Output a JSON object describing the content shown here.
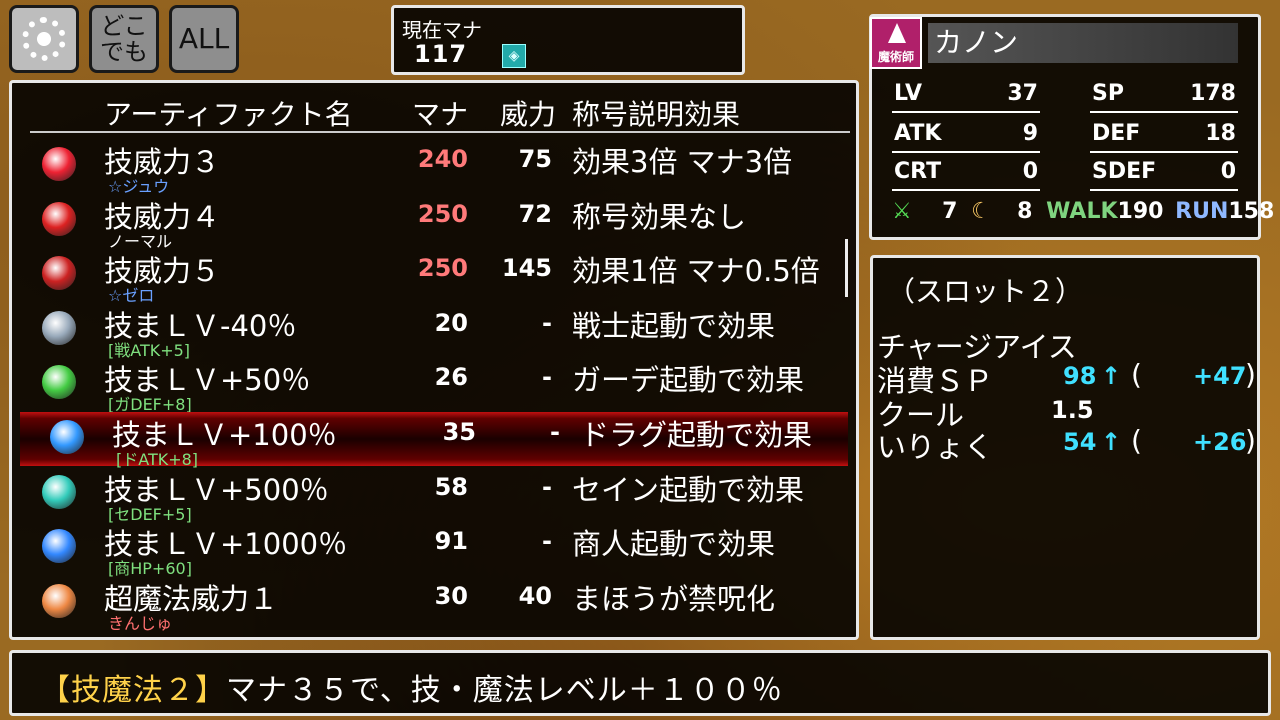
{
  "top_buttons": {
    "settings_icon": "gear-icon",
    "anywhere_label": "どこでも",
    "all_label": "ALL"
  },
  "mana": {
    "label": "現在マナ",
    "value": "117",
    "icon": "mana-crystal-icon"
  },
  "list": {
    "headers": {
      "name": "アーティファクト名",
      "mana": "マナ",
      "power": "威力",
      "effect": "称号説明効果"
    },
    "rows": [
      {
        "name": "技威力３",
        "sub": "☆ジュウ",
        "sub_color": "#6aa0ff",
        "mana": "240",
        "mana_color": "#ff7a7a",
        "power": "75",
        "effect": "効果3倍 マナ3倍",
        "icon": "plant-monster-icon",
        "icon_color": "#e23"
      },
      {
        "name": "技威力４",
        "sub": "ノーマル",
        "sub_color": "#ffffff",
        "mana": "250",
        "mana_color": "#ff7a7a",
        "power": "72",
        "effect": "称号効果なし",
        "icon": "plant-monster-icon",
        "icon_color": "#d22"
      },
      {
        "name": "技威力５",
        "sub": "☆ゼロ",
        "sub_color": "#6aa0ff",
        "mana": "250",
        "mana_color": "#ff7a7a",
        "power": "145",
        "effect": "効果1倍 マナ0.5倍",
        "icon": "radish-monster-icon",
        "icon_color": "#c22"
      },
      {
        "name": "技まＬＶ-40％",
        "sub": "[戦ATK+5]",
        "sub_color": "#7fe07f",
        "mana": "20",
        "mana_color": "#ffffff",
        "power": "-",
        "effect": "戦士起動で効果",
        "icon": "ring-icon",
        "icon_color": "#9ab"
      },
      {
        "name": "技まＬＶ+50％",
        "sub": "[ガDEF+8]",
        "sub_color": "#7fe07f",
        "mana": "26",
        "mana_color": "#ffffff",
        "power": "-",
        "effect": "ガーデ起動で効果",
        "icon": "gem-ring-icon",
        "icon_color": "#4c4"
      },
      {
        "name": "技まＬＶ+100％",
        "sub": "[ドATK+8]",
        "sub_color": "#7fe07f",
        "mana": "35",
        "mana_color": "#ffffff",
        "power": "-",
        "effect": "ドラグ起動で効果",
        "icon": "blue-gem-ring-icon",
        "icon_color": "#39f",
        "selected": true
      },
      {
        "name": "技まＬＶ+500％",
        "sub": "[セDEF+5]",
        "sub_color": "#7fe07f",
        "mana": "58",
        "mana_color": "#ffffff",
        "power": "-",
        "effect": "セイン起動で効果",
        "icon": "gold-gem-ring-icon",
        "icon_color": "#3cb"
      },
      {
        "name": "技まＬＶ+1000％",
        "sub": "[商HP+60]",
        "sub_color": "#7fe07f",
        "mana": "91",
        "mana_color": "#ffffff",
        "power": "-",
        "effect": "商人起動で効果",
        "icon": "gold-sapphire-ring-icon",
        "icon_color": "#38f"
      },
      {
        "name": "超魔法威力１",
        "sub": "きんじゅ",
        "sub_color": "#ff7070",
        "mana": "30",
        "mana_color": "#ffffff",
        "power": "40",
        "effect": "まほうが禁呪化",
        "icon": "spellbook-icon",
        "icon_color": "#e84"
      }
    ]
  },
  "character": {
    "job": "魔術師",
    "name": "カノン",
    "lv_label": "LV",
    "lv": "37",
    "sp_label": "SP",
    "sp": "178",
    "atk_label": "ATK",
    "atk": "9",
    "def_label": "DEF",
    "def": "18",
    "crt_label": "CRT",
    "crt": "0",
    "sdef_label": "SDEF",
    "sdef": "0",
    "sword_icon": "sword-icon",
    "sword_val": "7",
    "magic_icon": "magic-icon",
    "magic_val": "8",
    "walk_label": "WALK",
    "walk": "190",
    "run_label": "RUN",
    "run": "158"
  },
  "slot": {
    "title": "（スロット２）",
    "skill": "チャージアイス",
    "sp_label": "消費ＳＰ",
    "sp_val": "98",
    "sp_arrow": "↑",
    "sp_open": "(",
    "sp_diff": "+47",
    "sp_close": ")",
    "cool_label": "クール",
    "cool_val": "1.5",
    "power_label": "いりょく",
    "power_val": "54",
    "power_arrow": "↑",
    "power_open": "(",
    "power_diff": "+26",
    "power_close": ")"
  },
  "description": {
    "prefix": "【技魔法２】",
    "text": "マナ３５で、技・魔法レベル＋１００％"
  }
}
